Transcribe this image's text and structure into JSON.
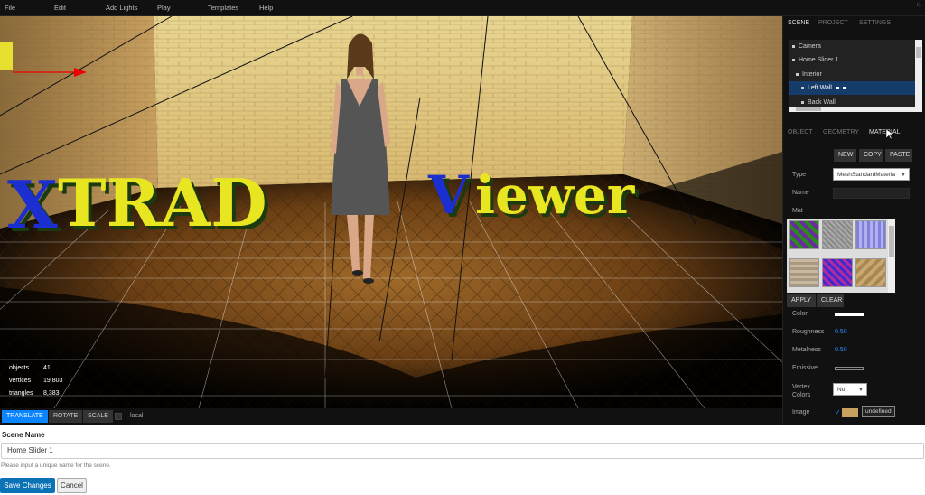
{
  "menubar": {
    "items": [
      "File",
      "Edit",
      "Add Lights",
      "Play",
      "Templates",
      "Help"
    ],
    "version": "r1"
  },
  "viewport": {
    "scene_text": "XTRAD Viewer",
    "stats": [
      {
        "label": "objects",
        "value": "41"
      },
      {
        "label": "vertices",
        "value": "19,803"
      },
      {
        "label": "triangles",
        "value": "8,383"
      }
    ]
  },
  "toolbar": {
    "translate": "TRANSLATE",
    "rotate": "ROTATE",
    "scale": "SCALE",
    "local": "local"
  },
  "sidebar": {
    "tabs": [
      "SCENE",
      "PROJECT",
      "SETTINGS"
    ],
    "outliner": [
      "Camera",
      "Home Slider 1",
      "Interior",
      "Left Wall",
      "Back Wall"
    ],
    "selected_item": "Left Wall",
    "prop_tabs": [
      "OBJECT",
      "GEOMETRY",
      "MATERIAL"
    ],
    "buttons": {
      "new": "NEW",
      "copy": "COPY",
      "paste": "PASTE",
      "apply": "APPLY",
      "clear": "CLEAR"
    },
    "labels": {
      "type": "Type",
      "name": "Name",
      "mat": "Mat",
      "color": "Color",
      "roughness": "Roughness",
      "metalness": "Metalness",
      "emissive": "Emissive",
      "vertex_colors": "Vertex Colors",
      "image": "Image"
    },
    "values": {
      "type": "MeshStandardMateria",
      "roughness": "0.50",
      "metalness": "0.50",
      "vertex_colors": "No",
      "image_undefined": "undefined"
    }
  },
  "form": {
    "title": "Scene Name",
    "value": "Home Slider 1",
    "help": "Please input a unique name for the scene.",
    "save": "Save Changes",
    "cancel": "Cancel"
  },
  "colors": {
    "accent": "#0a84ff",
    "save": "#0b72b5",
    "selected_row": "#153c6b",
    "number": "#2a8cff"
  }
}
